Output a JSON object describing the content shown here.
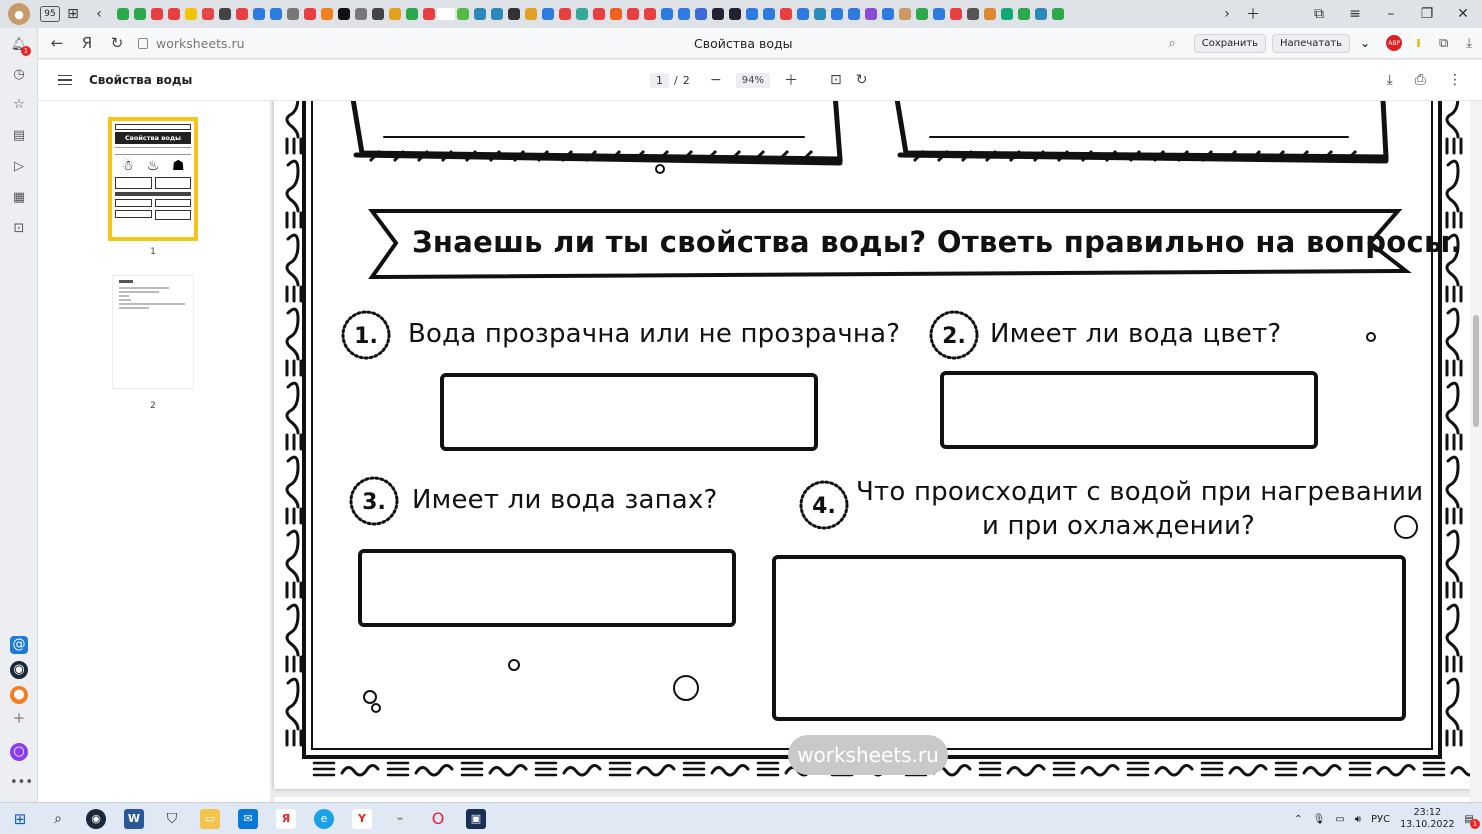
{
  "browser": {
    "tab_counter": "95",
    "address": "worksheets.ru",
    "page_title": "Свойства воды",
    "save_label": "Сохранить",
    "print_label": "Напечатать",
    "abp_label": "ABP",
    "notification_count": "1"
  },
  "pdf_toolbar": {
    "doc_title": "Свойства воды",
    "current_page": "1",
    "page_separator": "/",
    "total_pages": "2",
    "zoom": "94%"
  },
  "thumbnails": [
    {
      "label": "1",
      "title": "Свойства воды"
    },
    {
      "label": "2"
    }
  ],
  "worksheet": {
    "banner": "Знаешь ли ты свойства воды? Ответь правильно на вопросы.",
    "questions": [
      {
        "number": "1.",
        "text": "Вода прозрачна или не прозрачна?"
      },
      {
        "number": "2.",
        "text": "Имеет ли вода цвет?"
      },
      {
        "number": "3.",
        "text": "Имеет ли вода запах?"
      },
      {
        "number": "4.",
        "text_line1": "Что происходит с водой при нагревании",
        "text_line2": "и при охлаждении?"
      }
    ],
    "watermark": "worksheets.ru"
  },
  "taskbar": {
    "language": "РУС",
    "time": "23:12",
    "date": "13.10.2022",
    "notification_count": "1"
  }
}
